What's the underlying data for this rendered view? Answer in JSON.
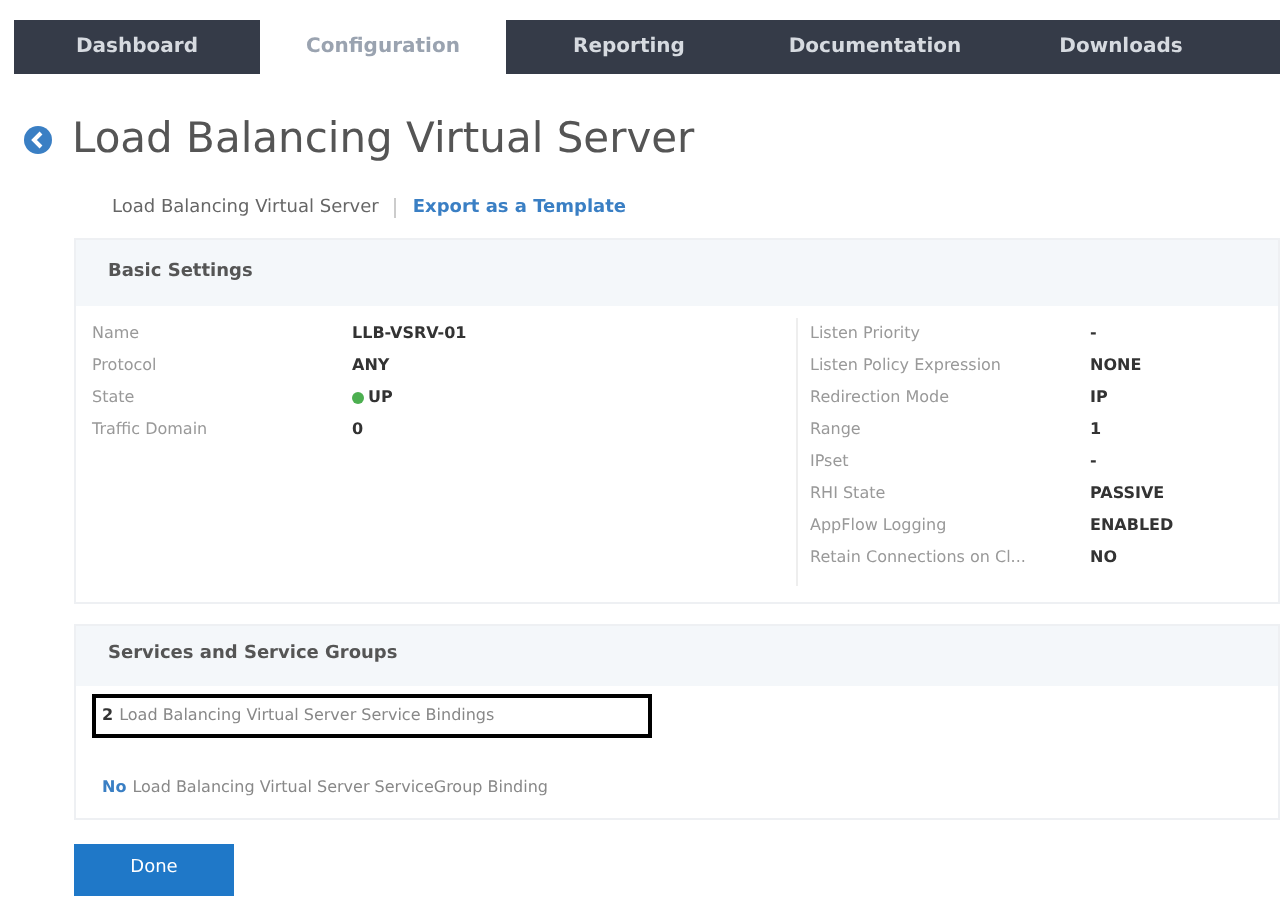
{
  "nav_tabs": [
    {
      "label": "Dashboard",
      "selected": false
    },
    {
      "label": "Configuration",
      "selected": true
    },
    {
      "label": "Reporting",
      "selected": false
    },
    {
      "label": "Documentation",
      "selected": false
    },
    {
      "label": "Downloads",
      "selected": false
    }
  ],
  "page_title": "Load Balancing Virtual Server",
  "breadcrumb": {
    "current": "Load Balancing Virtual Server",
    "link": "Export as a Template"
  },
  "basic_settings": {
    "title": "Basic Settings",
    "left": [
      {
        "label": "Name",
        "value": "LLB-VSRV-01"
      },
      {
        "label": "Protocol",
        "value": "ANY"
      },
      {
        "label": "State",
        "value": "UP",
        "color": "#4caf50"
      },
      {
        "label": "Traffic Domain",
        "value": "0"
      }
    ],
    "right": [
      {
        "label": "Listen Priority",
        "value": "-"
      },
      {
        "label": "Listen Policy Expression",
        "value": "NONE"
      },
      {
        "label": "Redirection Mode",
        "value": "IP"
      },
      {
        "label": "Range",
        "value": "1"
      },
      {
        "label": "IPset",
        "value": "-"
      },
      {
        "label": "RHI State",
        "value": "PASSIVE"
      },
      {
        "label": "AppFlow Logging",
        "value": "ENABLED"
      },
      {
        "label": "Retain Connections on Cl...",
        "value": "NO"
      }
    ]
  },
  "services": {
    "title": "Services and Service Groups",
    "bindings": [
      {
        "count": "2",
        "text": "Load Balancing Virtual Server Service Bindings",
        "highlighted": true
      },
      {
        "count": "No",
        "text": "Load Balancing Virtual Server ServiceGroup Binding",
        "highlighted": false
      }
    ]
  },
  "done_button": "Done"
}
